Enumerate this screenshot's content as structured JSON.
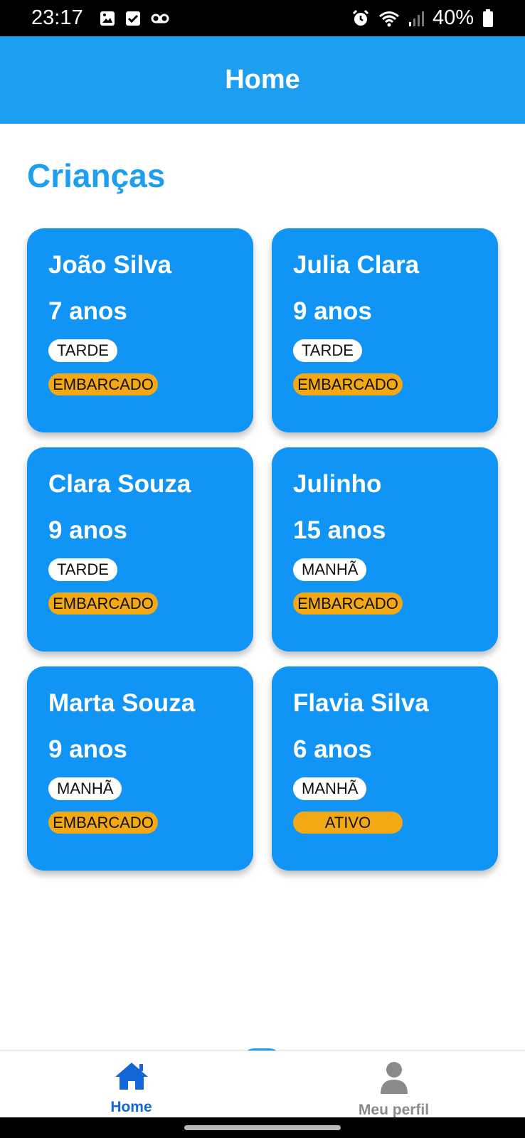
{
  "status_bar": {
    "time": "23:17",
    "battery": "40%",
    "icons_left": [
      "gallery-icon",
      "check-icon",
      "voicemail-icon"
    ],
    "icons_right": [
      "alarm-icon",
      "wifi-icon",
      "signal-icon",
      "battery-icon"
    ]
  },
  "header": {
    "title": "Home"
  },
  "section": {
    "title": "Crianças"
  },
  "cards": [
    {
      "name": "João Silva",
      "age": "7 anos",
      "shift": "TARDE",
      "status": "EMBARCADO"
    },
    {
      "name": "Julia Clara",
      "age": "9 anos",
      "shift": "TARDE",
      "status": "EMBARCADO"
    },
    {
      "name": "Clara Souza",
      "age": "9 anos",
      "shift": "TARDE",
      "status": "EMBARCADO"
    },
    {
      "name": "Julinho",
      "age": "15 anos",
      "shift": "MANHÃ",
      "status": "EMBARCADO"
    },
    {
      "name": "Marta Souza",
      "age": "9 anos",
      "shift": "MANHÃ",
      "status": "EMBARCADO"
    },
    {
      "name": "Flavia Silva",
      "age": "6 anos",
      "shift": "MANHÃ",
      "status": "ATIVO"
    }
  ],
  "bottom_nav": {
    "items": [
      {
        "label": "Home",
        "icon": "home-icon",
        "active": true
      },
      {
        "label": "Meu perfil",
        "icon": "person-icon",
        "active": false
      }
    ]
  },
  "colors": {
    "primary": "#1c9ff0",
    "card": "#1095f7",
    "status_badge": "#f2a914",
    "nav_active": "#1566d6",
    "nav_inactive": "#8a8a8a"
  }
}
